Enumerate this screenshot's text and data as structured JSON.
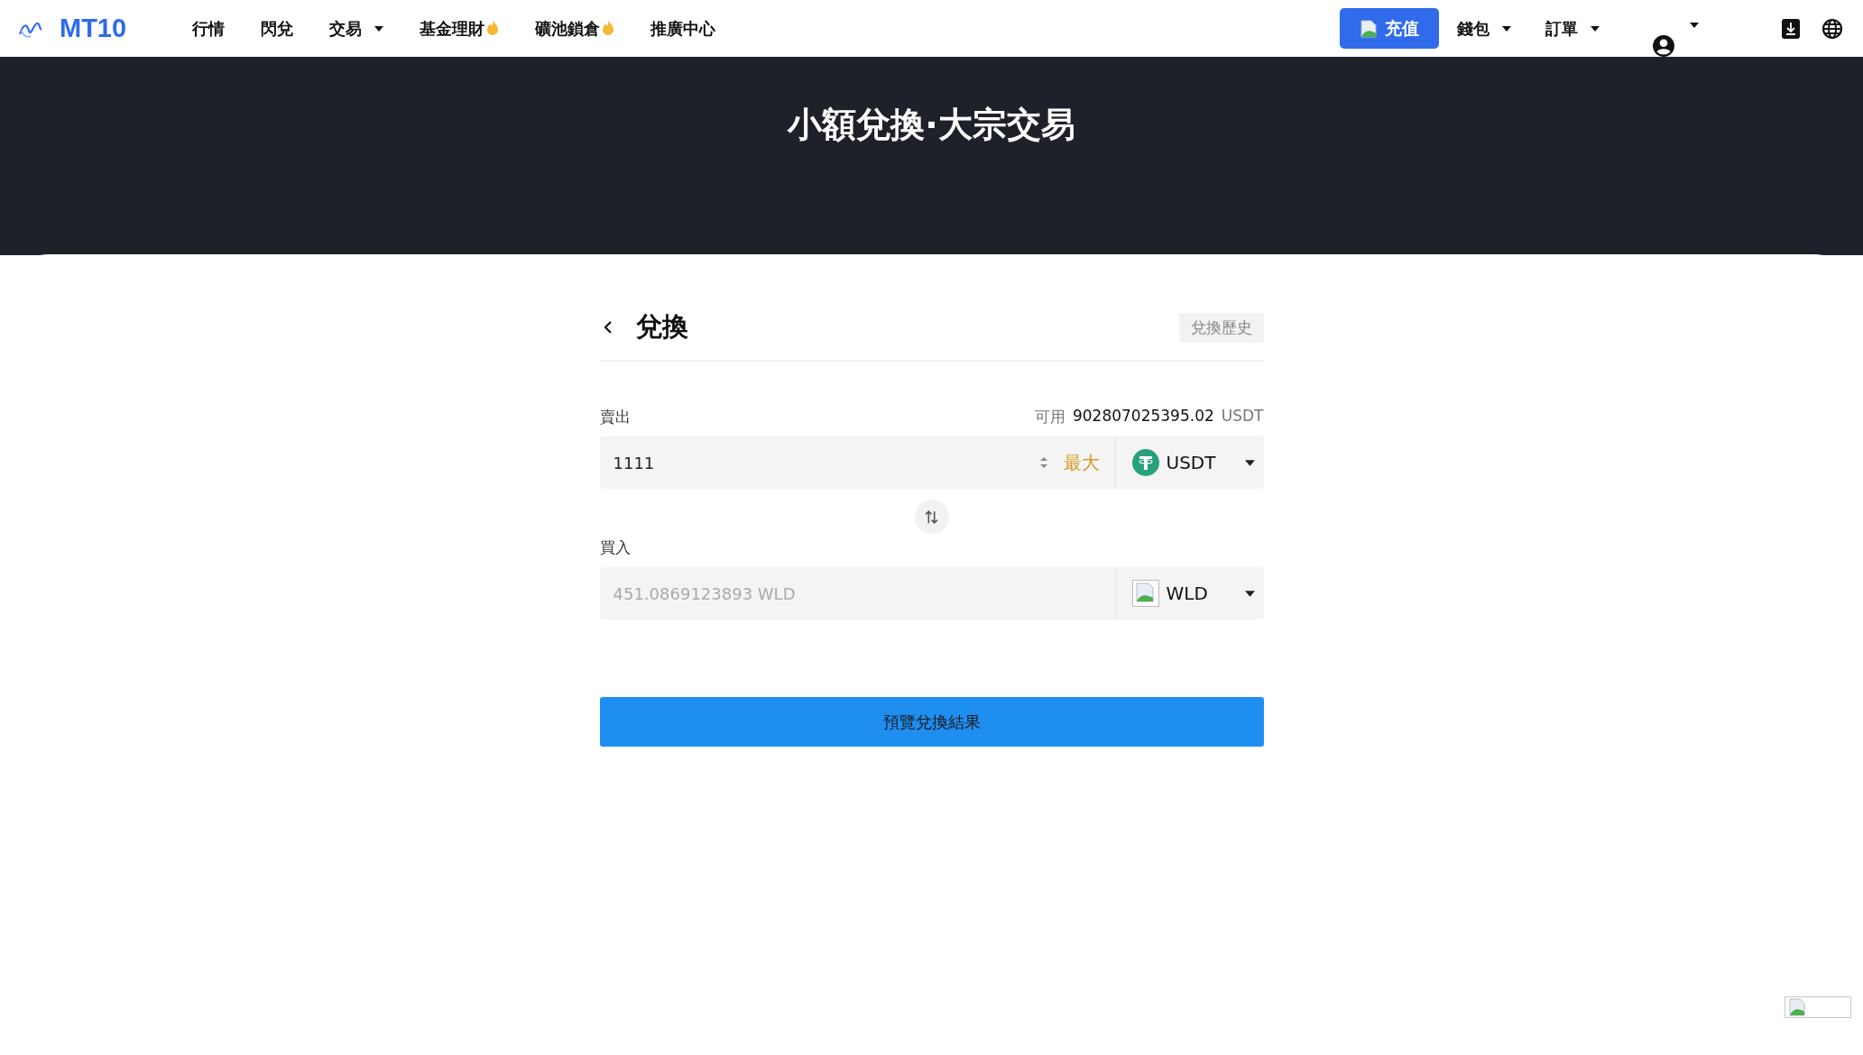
{
  "nav": {
    "logo": "MT10",
    "items": [
      {
        "label": "行情",
        "dropdown": false,
        "hot": false
      },
      {
        "label": "閃兌",
        "dropdown": false,
        "hot": false
      },
      {
        "label": "交易",
        "dropdown": true,
        "hot": false
      },
      {
        "label": "基金理財",
        "dropdown": false,
        "hot": true
      },
      {
        "label": "礦池鎖倉",
        "dropdown": false,
        "hot": true
      },
      {
        "label": "推廣中心",
        "dropdown": false,
        "hot": false
      }
    ],
    "deposit_button": "充值",
    "right_items": [
      {
        "label": "錢包"
      },
      {
        "label": "訂單"
      }
    ]
  },
  "hero": {
    "title": "小額兌換·大宗交易"
  },
  "exchange": {
    "title": "兌換",
    "history_button": "兌換歷史",
    "sell": {
      "label": "賣出",
      "available_label": "可用",
      "available_amount": "902807025395.02",
      "available_unit": "USDT",
      "value": "1111",
      "max_button": "最大",
      "token": "USDT"
    },
    "buy": {
      "label": "買入",
      "value": "451.0869123893 WLD",
      "token": "WLD"
    },
    "preview_button": "預覽兌換結果"
  }
}
